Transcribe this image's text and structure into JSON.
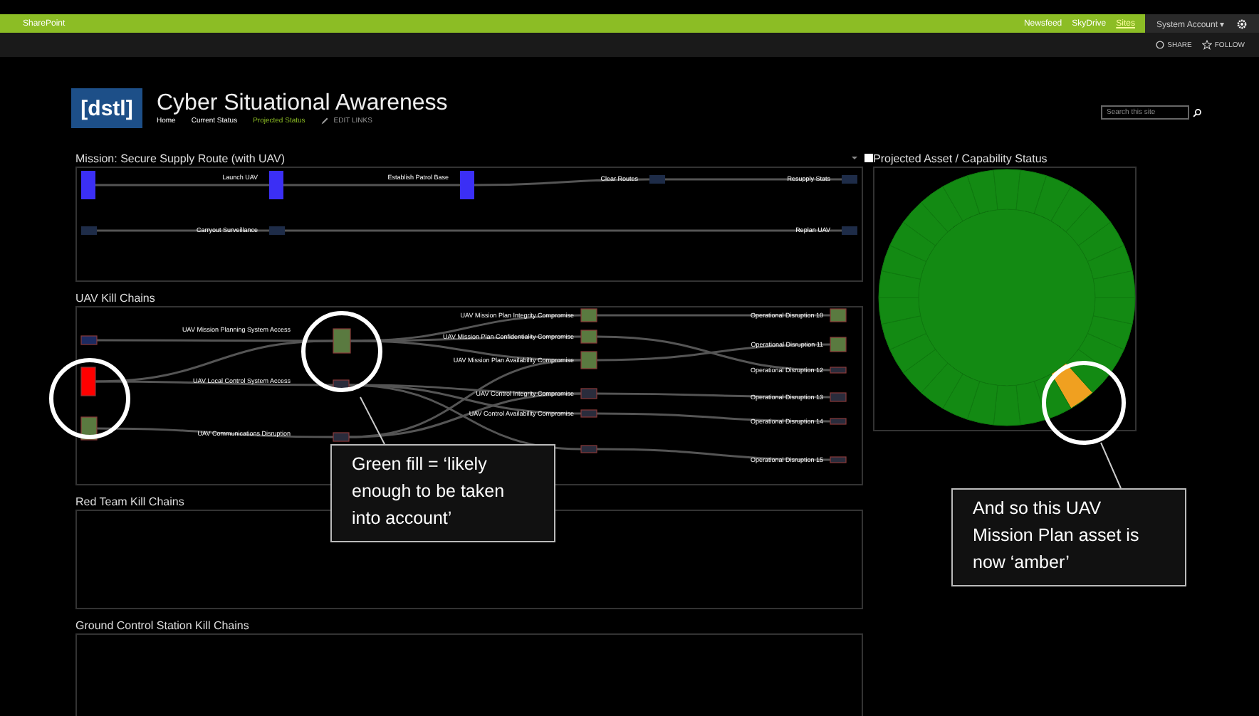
{
  "suite_bar": {
    "brand": "SharePoint",
    "links": [
      {
        "label": "Newsfeed",
        "selected": false
      },
      {
        "label": "SkyDrive",
        "selected": false
      },
      {
        "label": "Sites",
        "selected": true
      }
    ],
    "account": "System Account",
    "account_caret": "▾"
  },
  "actions": [
    {
      "kind": "share",
      "label": "SHARE"
    },
    {
      "kind": "follow",
      "label": "FOLLOW"
    }
  ],
  "site": {
    "logo": "[dstl]",
    "title": "Cyber Situational Awareness",
    "nav": [
      {
        "label": "Home",
        "selected": false
      },
      {
        "label": "Current Status",
        "selected": false
      },
      {
        "label": "Projected Status",
        "selected": true
      }
    ],
    "edit_links": "EDIT LINKS",
    "search": {
      "placeholder": "Search this site"
    }
  },
  "mission": {
    "title": "Mission: Secure Supply Route (with UAV)",
    "nodes": [
      {
        "color": "#3b2ff5"
      },
      {
        "label": "Launch UAV",
        "color": "#3b2ff5"
      },
      {
        "label": "Establish Patrol Base",
        "color": "#3b2ff5"
      },
      {
        "label": "Clear Routes",
        "color": "#1e2c48"
      },
      {
        "label": "Resupply Stats",
        "color": "#1e2c48"
      },
      {
        "color": "#1e2c48"
      },
      {
        "label": "Carryout Surveillance",
        "color": "#1e2c48"
      },
      {
        "label": "Replan UAV",
        "color": "#1e2c48"
      }
    ]
  },
  "kill_chains": {
    "title": "UAV Kill Chains",
    "nodes": [
      {
        "color": "#1c2a60"
      },
      {
        "color": "#ff0000"
      },
      {
        "color": "#5a7a40"
      },
      {
        "label": "UAV Mission Planning System Access",
        "color": "#5a7a40"
      },
      {
        "label": "UAV Local Control System Access",
        "color": "#2a2c3c"
      },
      {
        "label": "UAV Communications Disruption",
        "color": "#2a2c3c"
      },
      {
        "label": "UAV Mission Plan Integrity Compromise",
        "color": "#5a7a40"
      },
      {
        "label": "UAV Mission Plan Confidentiality Compromise",
        "color": "#5a7a40"
      },
      {
        "label": "UAV Mission Plan Availability Compromise",
        "color": "#5a7a40"
      },
      {
        "label": "UAV Control Integrity Compromise",
        "color": "#2a2c3c"
      },
      {
        "label": "UAV Control Availability Compromise",
        "color": "#2a2c3c"
      },
      {
        "color": "#2a2c3c"
      },
      {
        "label": "Operational Disruption 10",
        "color": "#5a7a40"
      },
      {
        "label": "Operational Disruption 11",
        "color": "#5a7a40"
      },
      {
        "label": "Operational Disruption 12",
        "color": "#2a2c3c"
      },
      {
        "label": "Operational Disruption 13",
        "color": "#2a2c3c"
      },
      {
        "label": "Operational Disruption 14",
        "color": "#2a2c3c"
      },
      {
        "label": "Operational Disruption 15",
        "color": "#2a2c3c"
      }
    ]
  },
  "red_team": {
    "title": "Red Team Kill Chains"
  },
  "ground_control": {
    "title": "Ground Control Station Kill Chains"
  },
  "asset_status": {
    "title": "Projected Asset / Capability Status",
    "segments": [
      {
        "color": "#138a13"
      },
      {
        "color": "#138a13"
      },
      {
        "color": "#138a13"
      },
      {
        "color": "#138a13"
      },
      {
        "color": "#f0a020"
      },
      {
        "color": "#138a13"
      },
      {
        "color": "#138a13"
      },
      {
        "color": "#138a13"
      },
      {
        "color": "#138a13"
      },
      {
        "color": "#138a13"
      },
      {
        "color": "#138a13"
      },
      {
        "color": "#138a13"
      },
      {
        "color": "#138a13"
      },
      {
        "color": "#138a13"
      },
      {
        "color": "#138a13"
      },
      {
        "color": "#138a13"
      },
      {
        "color": "#138a13"
      },
      {
        "color": "#138a13"
      },
      {
        "color": "#138a13"
      },
      {
        "color": "#138a13"
      },
      {
        "color": "#138a13"
      },
      {
        "color": "#138a13"
      },
      {
        "color": "#138a13"
      },
      {
        "color": "#138a13"
      },
      {
        "color": "#138a13"
      },
      {
        "color": "#138a13"
      },
      {
        "color": "#138a13"
      },
      {
        "color": "#138a13"
      },
      {
        "color": "#138a13"
      },
      {
        "color": "#138a13"
      }
    ]
  },
  "callouts": [
    {
      "text": "Green fill = ‘likely enough to be taken into account’"
    },
    {
      "text": "And so this UAV Mission Plan asset is now ‘amber’"
    }
  ]
}
